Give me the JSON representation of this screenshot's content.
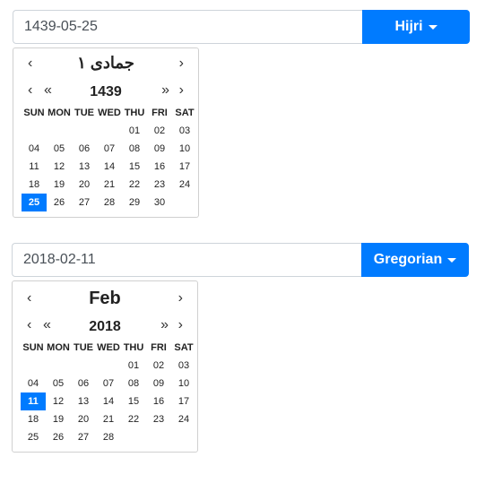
{
  "hijri": {
    "input_value": "1439-05-25",
    "calendar_button": "Hijri",
    "month_label": "جمادى ١",
    "year_label": "1439",
    "weekdays": [
      "SUN",
      "MON",
      "TUE",
      "WED",
      "THU",
      "FRI",
      "SAT"
    ],
    "weeks": [
      [
        "",
        "",
        "",
        "",
        "01",
        "02",
        "03"
      ],
      [
        "04",
        "05",
        "06",
        "07",
        "08",
        "09",
        "10"
      ],
      [
        "11",
        "12",
        "13",
        "14",
        "15",
        "16",
        "17"
      ],
      [
        "18",
        "19",
        "20",
        "21",
        "22",
        "23",
        "24"
      ],
      [
        "25",
        "26",
        "27",
        "28",
        "29",
        "30",
        ""
      ]
    ],
    "selected_day": "25"
  },
  "gregorian": {
    "input_value": "2018-02-11",
    "calendar_button": "Gregorian",
    "month_label": "Feb",
    "year_label": "2018",
    "weekdays": [
      "SUN",
      "MON",
      "TUE",
      "WED",
      "THU",
      "FRI",
      "SAT"
    ],
    "weeks": [
      [
        "",
        "",
        "",
        "",
        "01",
        "02",
        "03"
      ],
      [
        "04",
        "05",
        "06",
        "07",
        "08",
        "09",
        "10"
      ],
      [
        "11",
        "12",
        "13",
        "14",
        "15",
        "16",
        "17"
      ],
      [
        "18",
        "19",
        "20",
        "21",
        "22",
        "23",
        "24"
      ],
      [
        "25",
        "26",
        "27",
        "28",
        "",
        "",
        ""
      ]
    ],
    "selected_day": "11"
  },
  "nav_glyphs": {
    "prev": "‹",
    "next": "›",
    "prev_fast": "«",
    "next_fast": "»"
  },
  "colors": {
    "accent": "#007bff",
    "border": "#ced4da"
  }
}
